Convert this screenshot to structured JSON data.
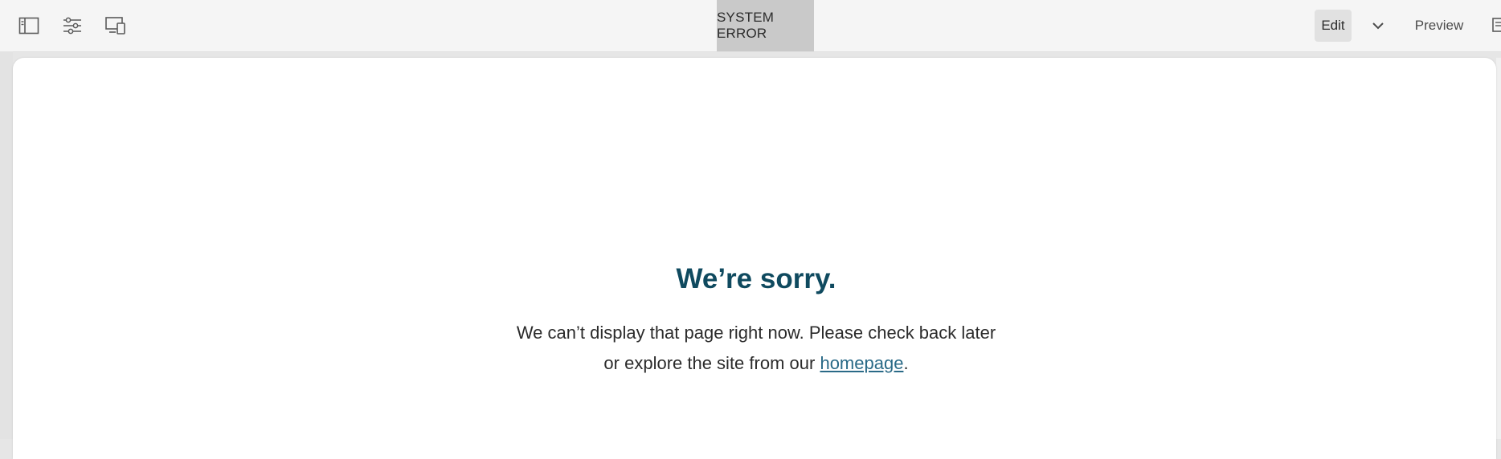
{
  "toolbar": {
    "center_title": "SYSTEM ERROR",
    "edit_label": "Edit",
    "preview_label": "Preview",
    "icons": [
      "side-panel-icon",
      "properties-icon",
      "device-emulator-icon",
      "chevron-down-icon",
      "annotations-icon"
    ]
  },
  "error": {
    "heading": "We’re sorry.",
    "line1": "We can’t display that page right now. Please check back later",
    "line2_prefix": "or explore the site from our",
    "link_text": "homepage",
    "line2_suffix": "."
  },
  "colors": {
    "heading": "#0f4a5f",
    "link": "#2a6a87",
    "toolbar_bg": "#f5f5f5",
    "title_highlight": "#c9c9c9"
  }
}
